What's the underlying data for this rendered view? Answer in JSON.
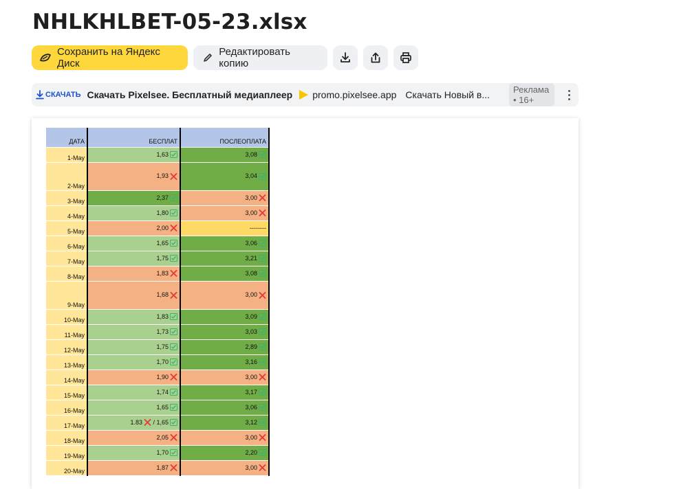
{
  "title": "NHLKHLBET-05-23.xlsx",
  "toolbar": {
    "save_label": "Сохранить на Яндекс Диск",
    "edit_label": "Редактировать копию",
    "download_icon": "download-icon",
    "share_icon": "share-icon",
    "print_icon": "print-icon"
  },
  "ad": {
    "download_label": "СКАЧАТЬ",
    "title": "Скачать Pixelsee. Бесплатный медиаплеер",
    "domain": "promo.pixelsee.app",
    "description": "Скачать Новый в...",
    "badge": "Реклама • 16+"
  },
  "colors": {
    "accent": "#fdd73c",
    "good_light": "#a9d08e",
    "good_dark": "#70ad47",
    "bad": "#f4b183",
    "pending": "#ffd966",
    "header": "#b4c6e7",
    "date": "#ffe699"
  },
  "sheet": {
    "headers": {
      "date": "ДАТА",
      "col_a": "БЕСПЛАТ",
      "col_b": "ПОСЛЕОПЛАТА"
    },
    "rows": [
      {
        "date": "1-May",
        "a": "1,63",
        "a_mark": "check",
        "a_fill": "g-light",
        "b": "3,08",
        "b_mark": "check",
        "b_fill": "g-dark"
      },
      {
        "date": "2-May",
        "a": "1,93",
        "a_mark": "cross",
        "a_fill": "orange",
        "b": "3,04",
        "b_mark": "check",
        "b_fill": "g-dark",
        "tall": true
      },
      {
        "date": "3-May",
        "a": "2,37",
        "a_mark": "check",
        "a_fill": "g-dark",
        "b": "3,00",
        "b_mark": "cross",
        "b_fill": "orange"
      },
      {
        "date": "4-May",
        "a": "1,80",
        "a_mark": "check",
        "a_fill": "g-light",
        "b": "3,00",
        "b_mark": "cross",
        "b_fill": "orange"
      },
      {
        "date": "5-May",
        "a": "2,00",
        "a_mark": "cross",
        "a_fill": "orange",
        "b": "--------",
        "b_mark": "",
        "b_fill": "yellow"
      },
      {
        "date": "6-May",
        "a": "1,65",
        "a_mark": "check",
        "a_fill": "g-light",
        "b": "3,06",
        "b_mark": "check",
        "b_fill": "g-dark"
      },
      {
        "date": "7-May",
        "a": "1,75",
        "a_mark": "check",
        "a_fill": "g-light",
        "b": "3,21",
        "b_mark": "check",
        "b_fill": "g-dark"
      },
      {
        "date": "8-May",
        "a": "1,83",
        "a_mark": "cross",
        "a_fill": "orange",
        "b": "3,08",
        "b_mark": "check",
        "b_fill": "g-dark"
      },
      {
        "date": "9-May",
        "a": "1,68",
        "a_mark": "cross",
        "a_fill": "orange",
        "b": "3,00",
        "b_mark": "cross",
        "b_fill": "orange",
        "tall": true
      },
      {
        "date": "10-May",
        "a": "1,83",
        "a_mark": "check",
        "a_fill": "g-light",
        "b": "3,09",
        "b_mark": "check",
        "b_fill": "g-dark"
      },
      {
        "date": "11-May",
        "a": "1,73",
        "a_mark": "check",
        "a_fill": "g-light",
        "b": "3,03",
        "b_mark": "check",
        "b_fill": "g-dark"
      },
      {
        "date": "12-May",
        "a": "1,75",
        "a_mark": "check",
        "a_fill": "g-light",
        "b": "2,89",
        "b_mark": "check",
        "b_fill": "g-dark"
      },
      {
        "date": "13-May",
        "a": "1,70",
        "a_mark": "check",
        "a_fill": "g-light",
        "b": "3,16",
        "b_mark": "check",
        "b_fill": "g-dark"
      },
      {
        "date": "14-May",
        "a": "1,90",
        "a_mark": "cross",
        "a_fill": "orange",
        "b": "3,00",
        "b_mark": "cross",
        "b_fill": "orange"
      },
      {
        "date": "15-May",
        "a": "1,74",
        "a_mark": "check",
        "a_fill": "g-light",
        "b": "3,17",
        "b_mark": "check",
        "b_fill": "g-dark"
      },
      {
        "date": "16-May",
        "a": "1,65",
        "a_mark": "check",
        "a_fill": "g-light",
        "b": "3,06",
        "b_mark": "check",
        "b_fill": "g-dark"
      },
      {
        "date": "17-May",
        "a": "1.83",
        "a_mark": "cross",
        "a_extra": " / 1,65",
        "a_extra_mark": "check",
        "a_fill": "g-light",
        "b": "3,12",
        "b_mark": "check",
        "b_fill": "g-dark"
      },
      {
        "date": "18-May",
        "a": "2,05",
        "a_mark": "cross",
        "a_fill": "orange",
        "b": "3,00",
        "b_mark": "cross",
        "b_fill": "orange"
      },
      {
        "date": "19-May",
        "a": "1,70",
        "a_mark": "check",
        "a_fill": "g-light",
        "b": "2,20",
        "b_mark": "check",
        "b_fill": "g-dark"
      },
      {
        "date": "20-May",
        "a": "1,87",
        "a_mark": "cross",
        "a_fill": "orange",
        "b": "3,00",
        "b_mark": "cross",
        "b_fill": "orange"
      }
    ]
  }
}
